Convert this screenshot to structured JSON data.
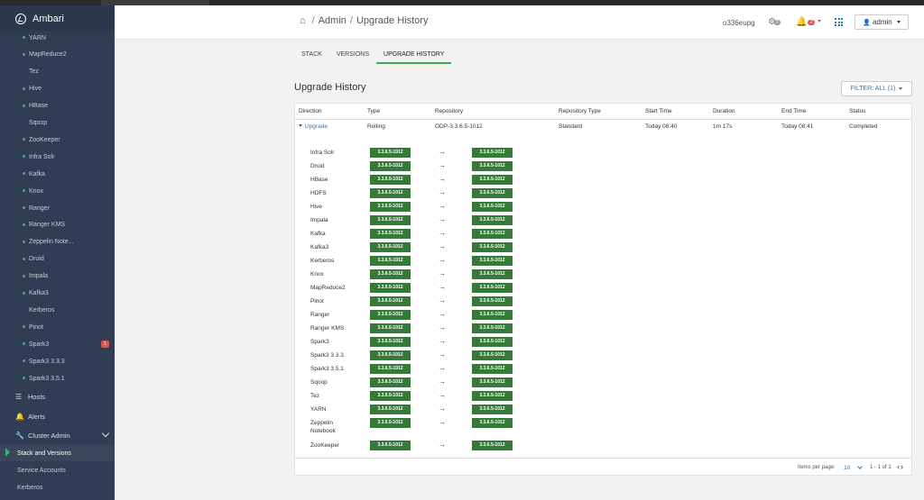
{
  "brand": {
    "name": "Ambari"
  },
  "sidebar": {
    "services": [
      {
        "label": "YARN",
        "dot": true,
        "badge": ""
      },
      {
        "label": "MapReduce2",
        "dot": true,
        "badge": ""
      },
      {
        "label": "Tez",
        "dot": false,
        "badge": ""
      },
      {
        "label": "Hive",
        "dot": true,
        "badge": ""
      },
      {
        "label": "HBase",
        "dot": true,
        "badge": ""
      },
      {
        "label": "Sqoop",
        "dot": false,
        "badge": ""
      },
      {
        "label": "ZooKeeper",
        "dot": true,
        "badge": ""
      },
      {
        "label": "Infra Solr",
        "dot": true,
        "badge": ""
      },
      {
        "label": "Kafka",
        "dot": true,
        "badge": ""
      },
      {
        "label": "Knox",
        "dot": true,
        "badge": ""
      },
      {
        "label": "Ranger",
        "dot": true,
        "badge": ""
      },
      {
        "label": "Ranger KMS",
        "dot": true,
        "badge": ""
      },
      {
        "label": "Zeppelin Note...",
        "dot": true,
        "badge": ""
      },
      {
        "label": "Druid",
        "dot": true,
        "badge": ""
      },
      {
        "label": "Impala",
        "dot": true,
        "badge": ""
      },
      {
        "label": "Kafka3",
        "dot": true,
        "badge": ""
      },
      {
        "label": "Kerberos",
        "dot": false,
        "badge": ""
      },
      {
        "label": "Pinot",
        "dot": true,
        "badge": ""
      },
      {
        "label": "Spark3",
        "dot": true,
        "badge": "1"
      },
      {
        "label": "Spark3 3.3.3",
        "dot": true,
        "badge": ""
      },
      {
        "label": "Spark3 3.5.1",
        "dot": true,
        "badge": ""
      }
    ],
    "nav": {
      "hosts": "Hosts",
      "alerts": "Alerts",
      "cluster_admin": "Cluster Admin"
    },
    "sub": {
      "stack_versions": "Stack and Versions",
      "service_accounts": "Service Accounts",
      "kerberos": "Kerberos"
    }
  },
  "header": {
    "breadcrumb_admin": "Admin",
    "breadcrumb_sep": "/",
    "breadcrumb_page": "Upgrade History",
    "cluster_name": "o336eupg",
    "ops_count": "0",
    "alerts_count": "2",
    "user": "admin"
  },
  "tabs": {
    "stack": "STACK",
    "versions": "VERSIONS",
    "history": "UPGRADE HISTORY"
  },
  "page": {
    "title": "Upgrade History",
    "filter": "FILTER: ALL (1)"
  },
  "table": {
    "headers": {
      "direction": "Direction",
      "type": "Type",
      "repository": "Repository",
      "repo_type": "Repository Type",
      "start": "Start Time",
      "duration": "Duration",
      "end": "End Time",
      "status": "Status"
    },
    "row": {
      "direction": "Upgrade",
      "type": "Rolling",
      "repository": "ODP-3.3.6.5-1012",
      "repo_type": "Standard",
      "start": "Today 08:40",
      "duration": "1m 17s",
      "end": "Today 08:41",
      "status": "Completed"
    },
    "components": [
      {
        "name": "Infra Solr",
        "from": "3.3.6.5-1012",
        "to": "3.3.6.5-1012"
      },
      {
        "name": "Druid",
        "from": "3.3.6.5-1012",
        "to": "3.3.6.5-1012"
      },
      {
        "name": "HBase",
        "from": "3.3.6.5-1012",
        "to": "3.3.6.5-1012"
      },
      {
        "name": "HDFS",
        "from": "3.3.6.5-1012",
        "to": "3.3.6.5-1012"
      },
      {
        "name": "Hive",
        "from": "3.3.6.5-1012",
        "to": "3.3.6.5-1012"
      },
      {
        "name": "Impala",
        "from": "3.3.6.5-1012",
        "to": "3.3.6.5-1012"
      },
      {
        "name": "Kafka",
        "from": "3.3.6.5-1012",
        "to": "3.3.6.5-1012"
      },
      {
        "name": "Kafka3",
        "from": "3.3.6.5-1012",
        "to": "3.3.6.5-1012"
      },
      {
        "name": "Kerberos",
        "from": "3.3.6.5-1012",
        "to": "3.3.6.5-1012"
      },
      {
        "name": "Knox",
        "from": "3.3.6.5-1012",
        "to": "3.3.6.5-1012"
      },
      {
        "name": "MapReduce2",
        "from": "3.3.6.5-1012",
        "to": "3.3.6.5-1012"
      },
      {
        "name": "Pinot",
        "from": "3.3.6.5-1012",
        "to": "3.3.6.5-1012"
      },
      {
        "name": "Ranger",
        "from": "3.3.6.5-1012",
        "to": "3.3.6.5-1012"
      },
      {
        "name": "Ranger KMS",
        "from": "3.3.6.5-1012",
        "to": "3.3.6.5-1012"
      },
      {
        "name": "Spark3",
        "from": "3.3.6.5-1012",
        "to": "3.3.6.5-1012"
      },
      {
        "name": "Spark3 3.3.3",
        "from": "3.3.6.5-1012",
        "to": "3.3.6.5-1012"
      },
      {
        "name": "Spark3 3.5.1",
        "from": "3.3.6.5-1012",
        "to": "3.3.6.5-1012"
      },
      {
        "name": "Sqoop",
        "from": "3.3.6.5-1012",
        "to": "3.3.6.5-1012"
      },
      {
        "name": "Tez",
        "from": "3.3.6.5-1012",
        "to": "3.3.6.5-1012"
      },
      {
        "name": "YARN",
        "from": "3.3.6.5-1012",
        "to": "3.3.6.5-1012"
      },
      {
        "name": "Zeppelin Notebook",
        "from": "3.3.6.5-1012",
        "to": "3.3.6.5-1012"
      },
      {
        "name": "ZooKeeper",
        "from": "3.3.6.5-1012",
        "to": "3.3.6.5-1012"
      }
    ],
    "footer": {
      "items_per_page_label": "Items per page:",
      "items_per_page": "10",
      "range": "1 - 1 of 1"
    }
  },
  "icons": {
    "arrow": "→",
    "home": "⌂",
    "gear": "⚙",
    "bell": "🔔",
    "user": "👤",
    "hosts": "☰",
    "alerts": "🔔",
    "wrench": "🔧",
    "pager": "‹›"
  },
  "colors": {
    "accent": "#3fae49",
    "link": "#2a7ab8",
    "version_badge": "#357a38",
    "sidebar": "#313d54",
    "alert": "#d9534f"
  }
}
